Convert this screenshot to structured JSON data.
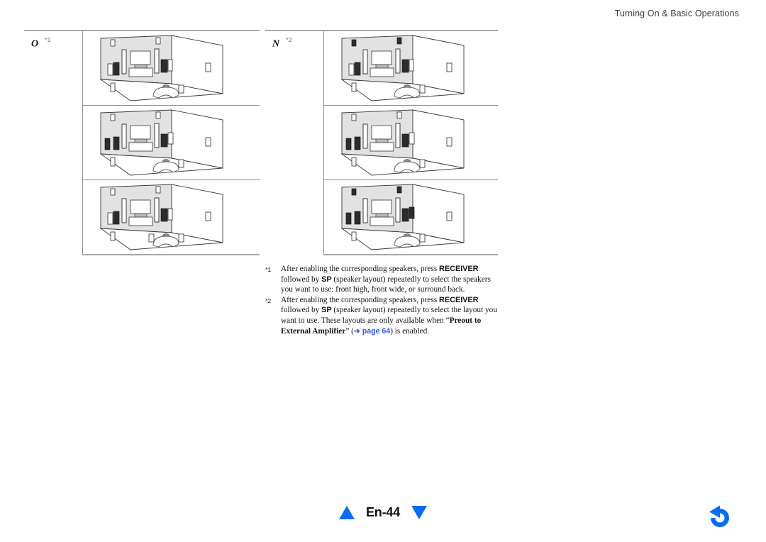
{
  "header": {
    "title": "Turning On & Basic Operations"
  },
  "tables": [
    {
      "id": "left",
      "label_letter": "O",
      "label_note": "*1",
      "rows": [
        {
          "diagram": "room-speaker-layout-diagram"
        },
        {
          "diagram": "room-speaker-layout-diagram"
        },
        {
          "diagram": "room-speaker-layout-diagram"
        }
      ]
    },
    {
      "id": "right",
      "label_letter": "N",
      "label_note": "*2",
      "rows": [
        {
          "diagram": "room-speaker-layout-diagram"
        },
        {
          "diagram": "room-speaker-layout-diagram"
        },
        {
          "diagram": "room-speaker-layout-diagram"
        }
      ]
    }
  ],
  "footnotes": [
    {
      "marker": "*1",
      "segments": [
        {
          "type": "text",
          "text": "After enabling the corresponding speakers, press "
        },
        {
          "type": "kbd",
          "text": "RECEIVER"
        },
        {
          "type": "text",
          "text": " followed by "
        },
        {
          "type": "kbd",
          "text": "SP"
        },
        {
          "type": "text",
          "text": " (speaker layout) repeatedly to select the speakers you want to use: front high, front wide, or surround back."
        }
      ]
    },
    {
      "marker": "*2",
      "segments": [
        {
          "type": "text",
          "text": "After enabling the corresponding speakers, press "
        },
        {
          "type": "kbd",
          "text": "RECEIVER"
        },
        {
          "type": "text",
          "text": " followed by "
        },
        {
          "type": "kbd",
          "text": "SP"
        },
        {
          "type": "text",
          "text": " (speaker layout) repeatedly to select the layout you want to use. These layouts are only available when "
        },
        {
          "type": "text",
          "text": "“"
        },
        {
          "type": "bold",
          "text": "Preout to External Amplifier"
        },
        {
          "type": "text",
          "text": "” ("
        },
        {
          "type": "xref",
          "text": "➔ page 64"
        },
        {
          "type": "text",
          "text": ") is enabled."
        }
      ]
    }
  ],
  "footer": {
    "page_label": "En-44",
    "prev_icon": "triangle-up-icon",
    "next_icon": "triangle-down-icon",
    "back_icon": "back-arrow-icon"
  },
  "colors": {
    "link_blue": "#2f5fe0",
    "nav_blue": "#0a6cf5",
    "note_blue": "#3f63d8",
    "rule_gray": "#a8a8ac",
    "wall_fill": "#e2e2e2"
  }
}
